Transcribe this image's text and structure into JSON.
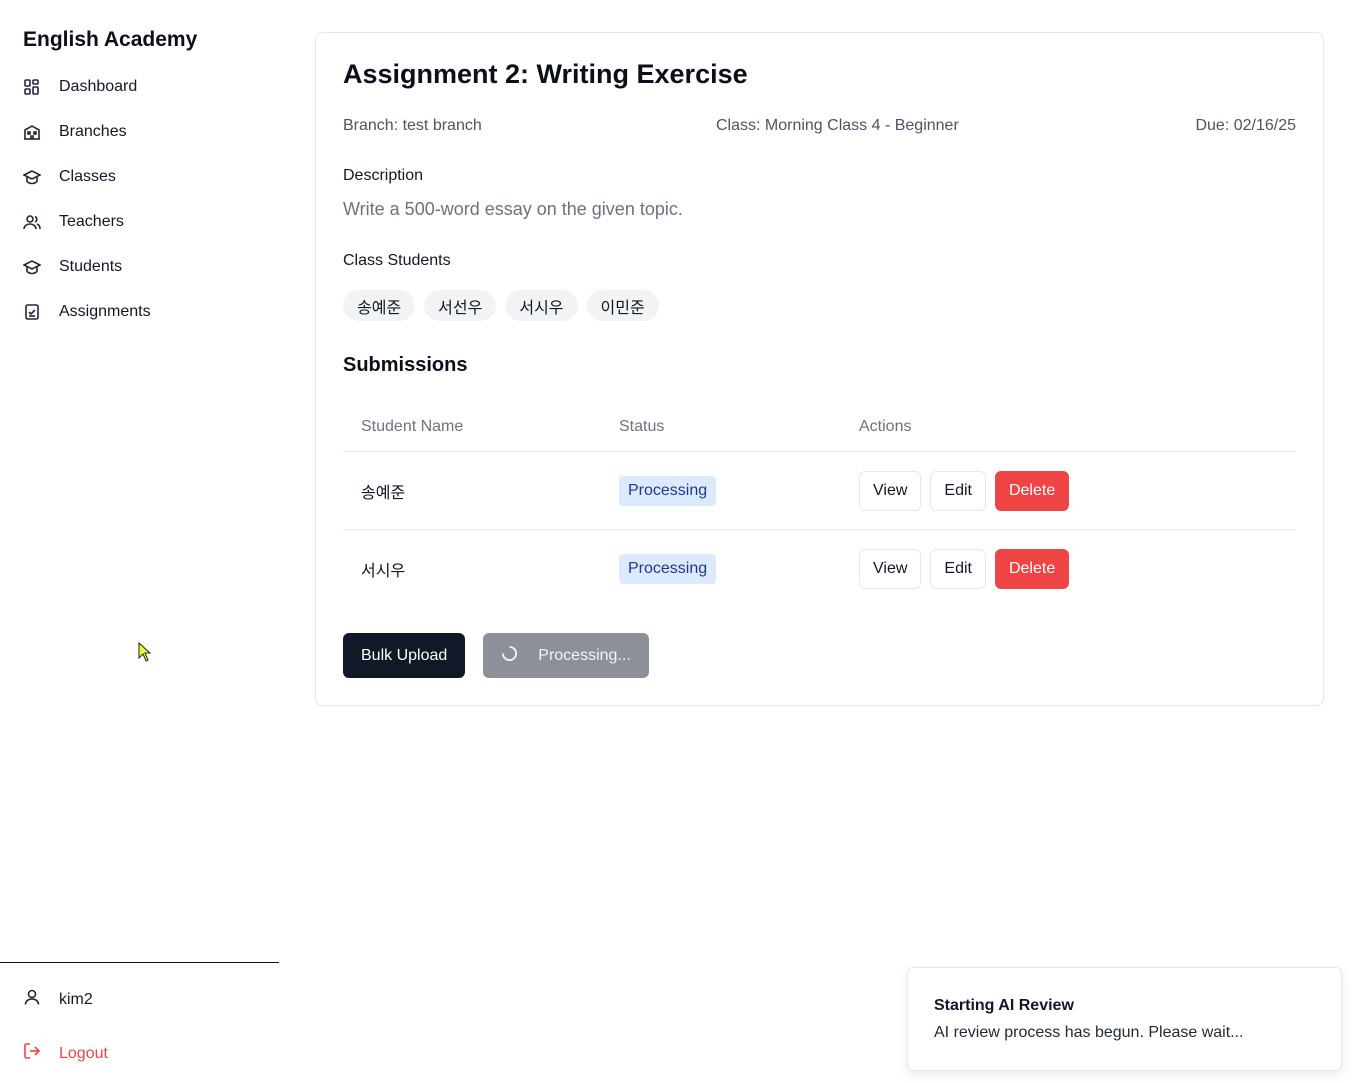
{
  "sidebar": {
    "brand": "English Academy",
    "items": [
      {
        "label": "Dashboard",
        "icon": "dashboard-icon"
      },
      {
        "label": "Branches",
        "icon": "building-icon"
      },
      {
        "label": "Classes",
        "icon": "graduation-cap-icon"
      },
      {
        "label": "Teachers",
        "icon": "users-icon"
      },
      {
        "label": "Students",
        "icon": "graduation-cap-icon"
      },
      {
        "label": "Assignments",
        "icon": "clipboard-check-icon"
      }
    ],
    "user": {
      "name": "kim2",
      "icon": "user-icon"
    },
    "logout": {
      "label": "Logout",
      "icon": "logout-icon",
      "color": "#ef4444"
    }
  },
  "assignment": {
    "title": "Assignment 2: Writing Exercise",
    "branch": "Branch: test branch",
    "class": "Class: Morning Class 4 - Beginner",
    "due": "Due: 02/16/25",
    "description_label": "Description",
    "description": "Write a 500-word essay on the given topic.",
    "students_label": "Class Students",
    "students": [
      "송예준",
      "서선우",
      "서시우",
      "이민준"
    ]
  },
  "submissions": {
    "title": "Submissions",
    "columns": [
      "Student Name",
      "Status",
      "Actions"
    ],
    "rows": [
      {
        "name": "송예준",
        "status": "Processing"
      },
      {
        "name": "서시우",
        "status": "Processing"
      }
    ],
    "actions": {
      "view": "View",
      "edit": "Edit",
      "delete": "Delete"
    }
  },
  "bottom_actions": {
    "bulk_upload": "Bulk Upload",
    "processing": "Processing..."
  },
  "toast": {
    "title": "Starting AI Review",
    "message": "AI review process has begun. Please wait..."
  },
  "colors": {
    "accent_dark": "#111827",
    "danger": "#ef4444",
    "badge_bg": "#dbeafe",
    "badge_text": "#1e3a8a"
  }
}
